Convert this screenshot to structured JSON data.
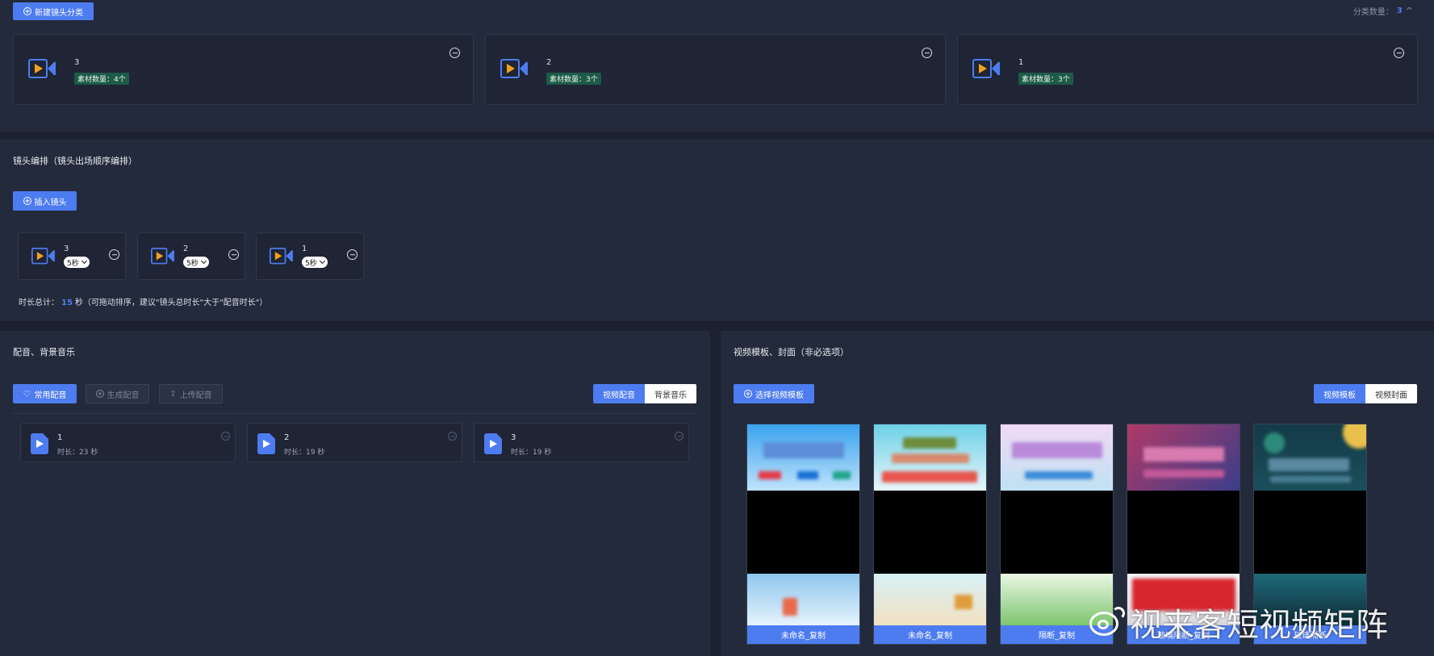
{
  "top": {
    "new_category_label": "新建镜头分类",
    "count_label": "分类数量：",
    "count_value": "3",
    "collapse_glyph": "^",
    "categories": [
      {
        "name": "3",
        "material": "素材数量：4个"
      },
      {
        "name": "2",
        "material": "素材数量：3个"
      },
      {
        "name": "1",
        "material": "素材数量：3个"
      }
    ]
  },
  "shots": {
    "title": "镜头编排（镜头出场顺序编排）",
    "insert_label": "插入镜头",
    "items": [
      {
        "name": "3",
        "duration": "5秒"
      },
      {
        "name": "2",
        "duration": "5秒"
      },
      {
        "name": "1",
        "duration": "5秒"
      }
    ],
    "total_prefix": "时长总计：",
    "total_value": "15",
    "total_suffix": "秒（可拖动排序，建议\"镜头总时长\"大于\"配音时长\"）"
  },
  "audio": {
    "title": "配音、背景音乐",
    "common_label": "常用配音",
    "generate_label": "生成配音",
    "upload_label": "上传配音",
    "tab_voice": "视频配音",
    "tab_bgm": "背景音乐",
    "items": [
      {
        "name": "1",
        "duration": "时长：23 秒"
      },
      {
        "name": "2",
        "duration": "时长：19 秒"
      },
      {
        "name": "3",
        "duration": "时长：19 秒"
      }
    ]
  },
  "templates": {
    "title": "视频模板、封面（非必选项）",
    "select_label": "选择视频模板",
    "tab_template": "视频模板",
    "tab_cover": "视频封面",
    "items": [
      {
        "caption": "未命名_复制"
      },
      {
        "caption": "未命名_复制"
      },
      {
        "caption": "隔断_复制"
      },
      {
        "caption": "玻璃隔断_复制"
      },
      {
        "caption": "玻璃隔断"
      }
    ]
  },
  "watermark": {
    "text": "视来客短视频矩阵"
  },
  "colors": {
    "accent": "#4d7cf0",
    "badge": "#1d5a48",
    "panel": "#232a3b",
    "background": "#1c2130"
  }
}
